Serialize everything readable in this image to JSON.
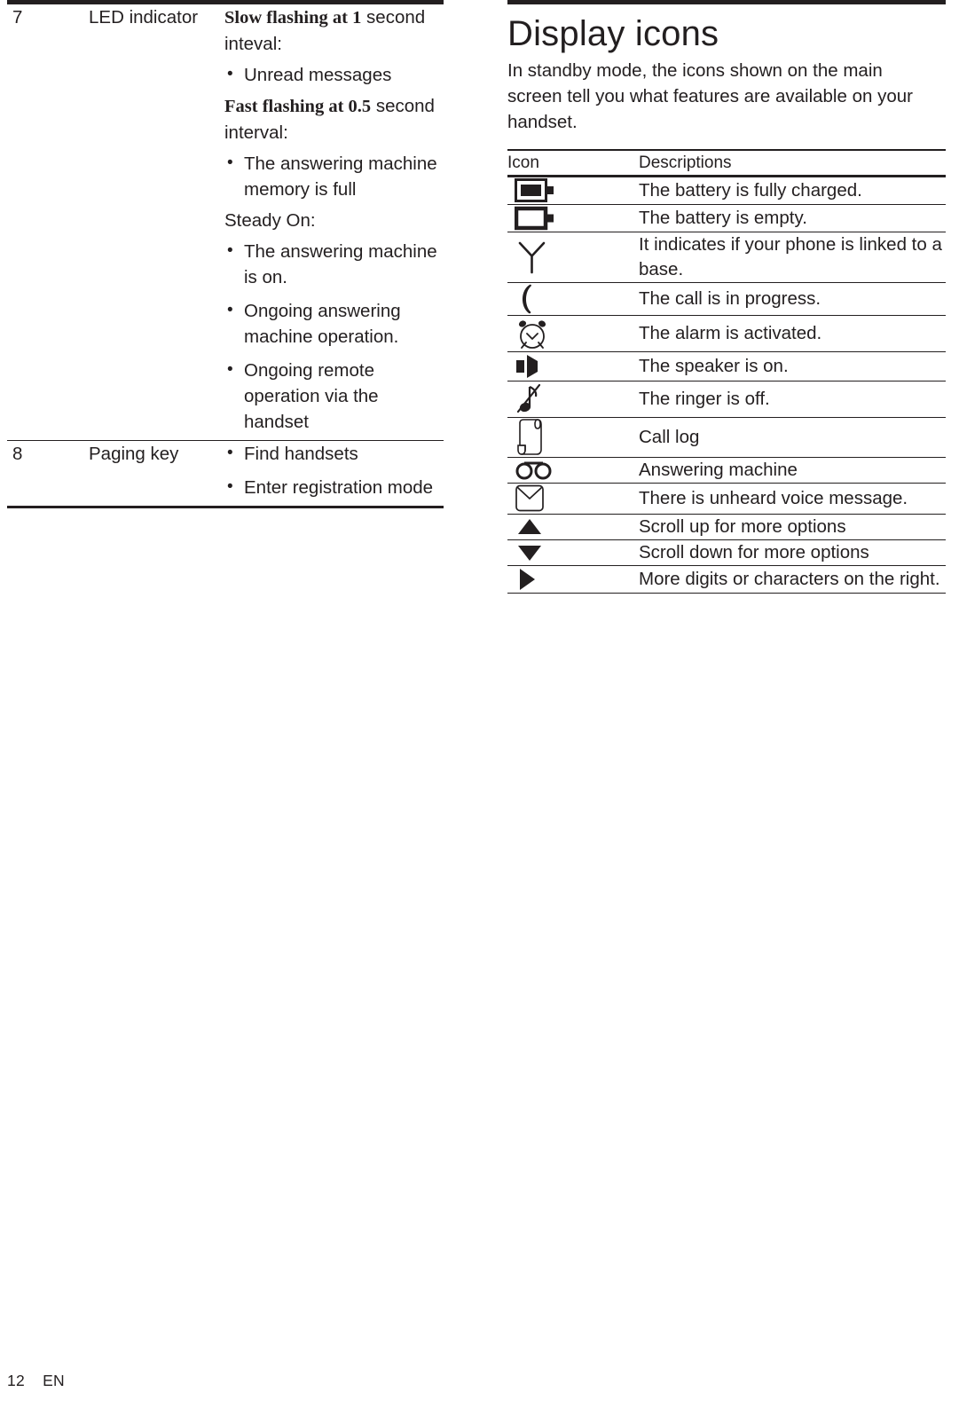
{
  "page": {
    "footer_page_number": "12",
    "footer_language": "EN"
  },
  "left_table": {
    "rows": [
      {
        "number": "7",
        "name": "LED indicator",
        "groups": [
          {
            "lead": "Slow flashing at 1 second inteval:",
            "lead_bold": "Slow flashing at 1",
            "lead_rest": " second inteval:",
            "bullets": [
              "Unread messages"
            ]
          },
          {
            "lead": "Fast flashing at 0.5 second interval:",
            "lead_bold": "Fast flashing at 0.5",
            "lead_rest": " second interval:",
            "bullets": [
              "The answering machine memory is full"
            ]
          },
          {
            "lead": "Steady On:",
            "lead_bold": "",
            "lead_rest": "Steady On:",
            "bullets": [
              "The answering machine is on.",
              "Ongoing answering machine operation.",
              "Ongoing remote operation via the handset"
            ]
          }
        ]
      },
      {
        "number": "8",
        "name": "Paging key",
        "groups": [
          {
            "lead": "",
            "lead_bold": "",
            "lead_rest": "",
            "bullets": [
              "Find handsets",
              "Enter registration mode"
            ]
          }
        ]
      }
    ]
  },
  "right_section": {
    "title": "Display icons",
    "intro": "In standby mode, the icons shown on the main screen tell you what features are available on your handset.",
    "table": {
      "headers": {
        "icon": "Icon",
        "description": "Descriptions"
      },
      "rows": [
        {
          "icon_name": "battery-full-icon",
          "description": "The battery is fully charged."
        },
        {
          "icon_name": "battery-empty-icon",
          "description": "The battery is empty."
        },
        {
          "icon_name": "antenna-link-icon",
          "description": "It indicates if your phone is linked to a base."
        },
        {
          "icon_name": "call-in-progress-icon",
          "description": "The call is in progress."
        },
        {
          "icon_name": "alarm-clock-icon",
          "description": "The alarm is activated."
        },
        {
          "icon_name": "speaker-on-icon",
          "description": "The speaker is on."
        },
        {
          "icon_name": "ringer-off-icon",
          "description": "The ringer is off."
        },
        {
          "icon_name": "call-log-icon",
          "description": "Call log"
        },
        {
          "icon_name": "answering-machine-icon",
          "description": "Answering machine"
        },
        {
          "icon_name": "voice-message-icon",
          "description": "There is unheard voice message."
        },
        {
          "icon_name": "scroll-up-icon",
          "description": "Scroll up for more options"
        },
        {
          "icon_name": "scroll-down-icon",
          "description": "Scroll down for more options"
        },
        {
          "icon_name": "scroll-right-icon",
          "description": "More digits or characters on the right."
        }
      ]
    }
  },
  "colors": {
    "ink": "#231f20",
    "paper": "#ffffff"
  }
}
